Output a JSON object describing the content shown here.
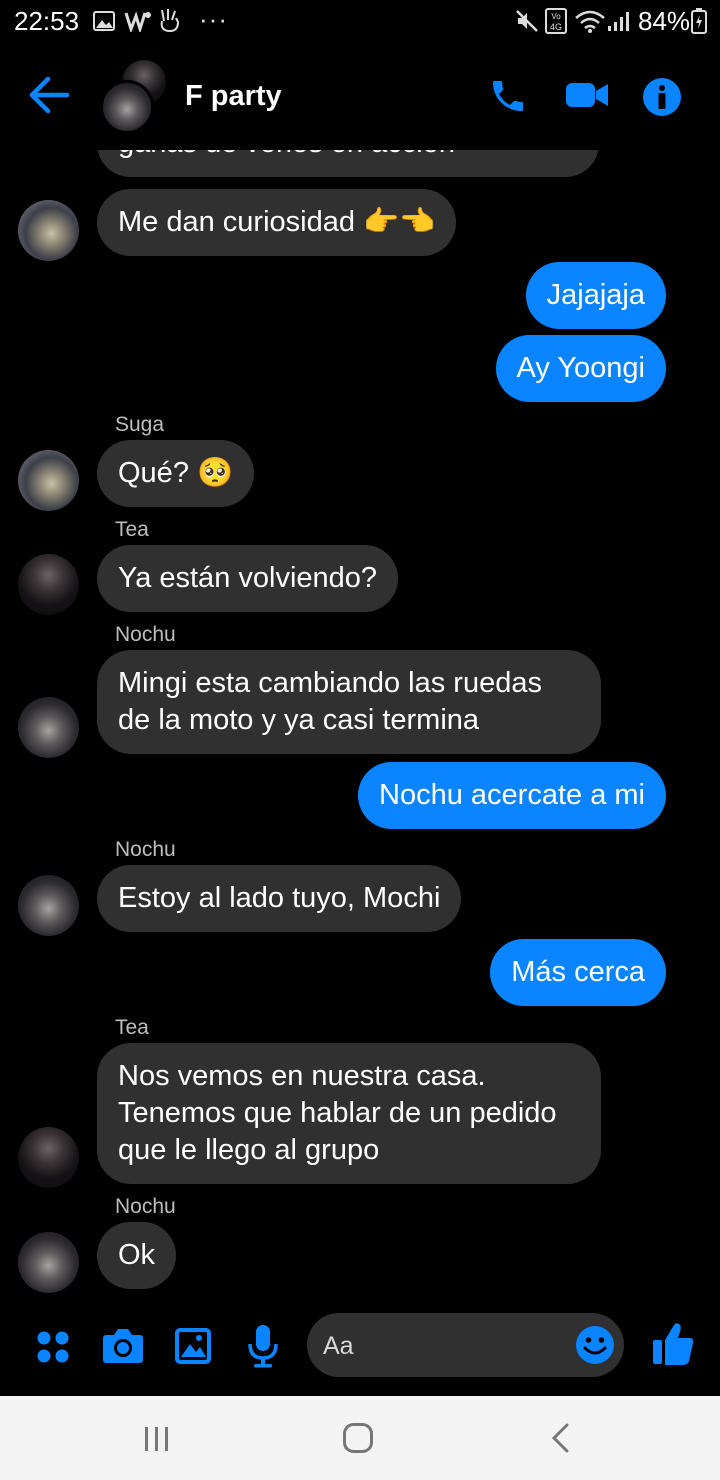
{
  "status_bar": {
    "time": "22:53",
    "overflow": "···",
    "battery": "84%"
  },
  "header": {
    "title": "F party"
  },
  "messages": [
    {
      "side": "in",
      "sender": "",
      "text": "ganas de verlos en acción",
      "avatar": "suga"
    },
    {
      "side": "in",
      "sender": "",
      "text": "Me dan curiosidad 👉👈",
      "avatar": "suga"
    },
    {
      "side": "out",
      "text": "Jajajaja"
    },
    {
      "side": "out",
      "text": "Ay Yoongi"
    },
    {
      "side": "in",
      "sender": "Suga",
      "text": "Qué? 🥺",
      "avatar": "suga"
    },
    {
      "side": "in",
      "sender": "Tea",
      "text": "Ya están volviendo?",
      "avatar": "tea"
    },
    {
      "side": "in",
      "sender": "Nochu",
      "text": "Mingi esta cambiando las ruedas de la moto y ya casi termina",
      "avatar": "nochu"
    },
    {
      "side": "out",
      "text": "Nochu acercate a mi"
    },
    {
      "side": "in",
      "sender": "Nochu",
      "text": "Estoy al lado tuyo, Mochi",
      "avatar": "nochu"
    },
    {
      "side": "out",
      "text": "Más cerca"
    },
    {
      "side": "in",
      "sender": "Tea",
      "text": "Nos vemos en nuestra casa. Tenemos que hablar de un pedido que le llego al grupo",
      "avatar": "tea"
    },
    {
      "side": "in",
      "sender": "Nochu",
      "text": "Ok",
      "avatar": "nochu"
    }
  ],
  "composer": {
    "placeholder": "Aa"
  },
  "colors": {
    "accent": "#0a84ff",
    "incoming_bubble": "#303030",
    "background": "#000000"
  },
  "icons": [
    "back-arrow-icon",
    "phone-icon",
    "video-icon",
    "info-icon",
    "menu-dots-icon",
    "camera-icon",
    "gallery-icon",
    "mic-icon",
    "emoji-icon",
    "thumbs-up-icon",
    "recents-icon",
    "home-icon",
    "back-nav-icon"
  ]
}
